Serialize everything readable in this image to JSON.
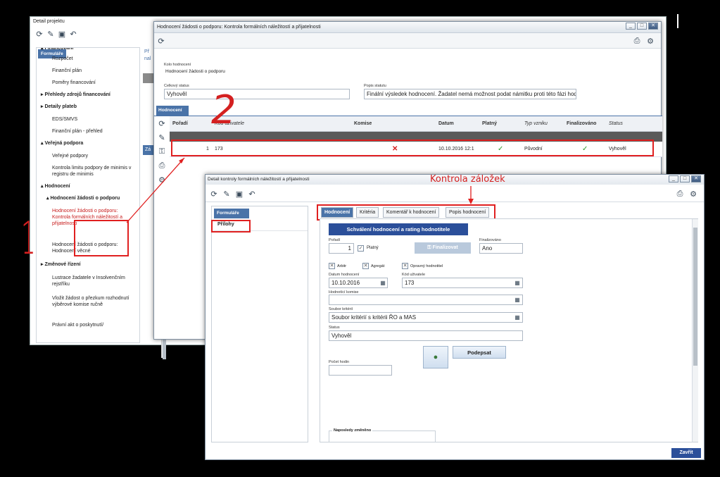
{
  "back_window": {
    "title": "Detail projektu",
    "sidebar_tab": "Formuláře",
    "items": [
      {
        "label": "▴ Financování",
        "bold": true
      },
      {
        "label": "Rozpočet"
      },
      {
        "label": "Finanční plán"
      },
      {
        "label": "Poměry financování"
      },
      {
        "label": "▸ Přehledy zdrojů financování",
        "bold": true
      },
      {
        "label": "▸ Detaily plateb",
        "bold": true
      },
      {
        "label": "EDS/SMVS"
      },
      {
        "label": "Finanční plán - přehled"
      },
      {
        "label": "▴ Veřejná podpora",
        "bold": true
      },
      {
        "label": "Veřejné podpory"
      },
      {
        "label": "Kontrola limitu podpory de minimis v registru de minimis"
      },
      {
        "label": "▴ Hodnocení",
        "bold": true
      },
      {
        "label": "▴ Hodnocení žádosti o podporu",
        "bold": true
      },
      {
        "label": "Hodnocení žádosti o podporu: Kontrola formálních náležitostí a přijatelnosti",
        "active": true
      },
      {
        "label": "Hodnocení žádosti o podporu: Hodnocení věcné"
      },
      {
        "label": "▸ Změnové řízení",
        "bold": true
      },
      {
        "label": "Lustrace žadatele v Insolvenčním rejstříku"
      },
      {
        "label": "Vložit žádost o přezkum rozhodnutí výběrové komise ručně"
      },
      {
        "label": "Právní akt o poskytnutí/"
      }
    ],
    "peek_text": "Př",
    "peek_text2": "nal",
    "peek_text3": "Zá"
  },
  "middle_window": {
    "title": "Hodnocení žádosti o podporu: Kontrola formálních náležitostí a přijatelnosti",
    "kolo_label": "Kolo hodnocení",
    "kolo_value": "Hodnocení žádosti o podporu",
    "celkovy_status_label": "Celkový status",
    "celkovy_status_value": "Vyhověl",
    "popis_statutu_label": "Popis statutu",
    "popis_statutu_value": "Finální výsledek hodnocení. Žadatel nemá možnost podat námitku proti této fázi hodno",
    "tab": "Hodnocení",
    "columns": [
      "Pořadí",
      "Kód uživatele",
      "Komise",
      "Datum",
      "Platný",
      "Typ vzniku",
      "Finalizováno",
      "Status"
    ],
    "row": {
      "poradi": "1",
      "kod": "173",
      "komise": "✕",
      "datum": "10.10.2016 12:1",
      "platny": "✓",
      "typ": "Původní",
      "finalizovano": "✓",
      "status": "Vyhověl"
    }
  },
  "front_window": {
    "title": "Detail kontroly formálních náležitostí a přijatelnosti",
    "left_tab": "Formuláře",
    "left_item": "Přílohy",
    "tabs": [
      "Hodnocení",
      "Kritéria",
      "Komentář k hodnocení",
      "Popis hodnocení"
    ],
    "approve_button": "Schválení hodnocení a rating hodnotitele",
    "poradi_label": "Pořadí",
    "poradi_value": "1",
    "platny_label": "Platný",
    "finalizovat_button": "Finalizovat",
    "finalizovano_label": "Finalizováno",
    "finalizovano_value": "Ano",
    "arbitr_label": "Arbitr",
    "agregat_label": "Agregát",
    "opravny_label": "Opravný hodnotitel",
    "datum_label": "Datum hodnocení",
    "datum_value": "10.10.2016",
    "kod_label": "Kód uživatele",
    "kod_value": "173",
    "komise_label": "Hodnotící komise",
    "soubor_label": "Soubor kritérií",
    "soubor_value": "Soubor kritérií s kritérii ŘO a MAS",
    "status_label": "Status",
    "status_value": "Vyhověl",
    "podepsat_button": "Podepsat",
    "pocet_hodin_label": "Počet hodin",
    "napo_label": "Naposledy změněno",
    "zavrit_button": "Zavřít"
  },
  "annotations": {
    "num1": "1",
    "num2": "2",
    "kontrola": "Kontrola záložek"
  }
}
